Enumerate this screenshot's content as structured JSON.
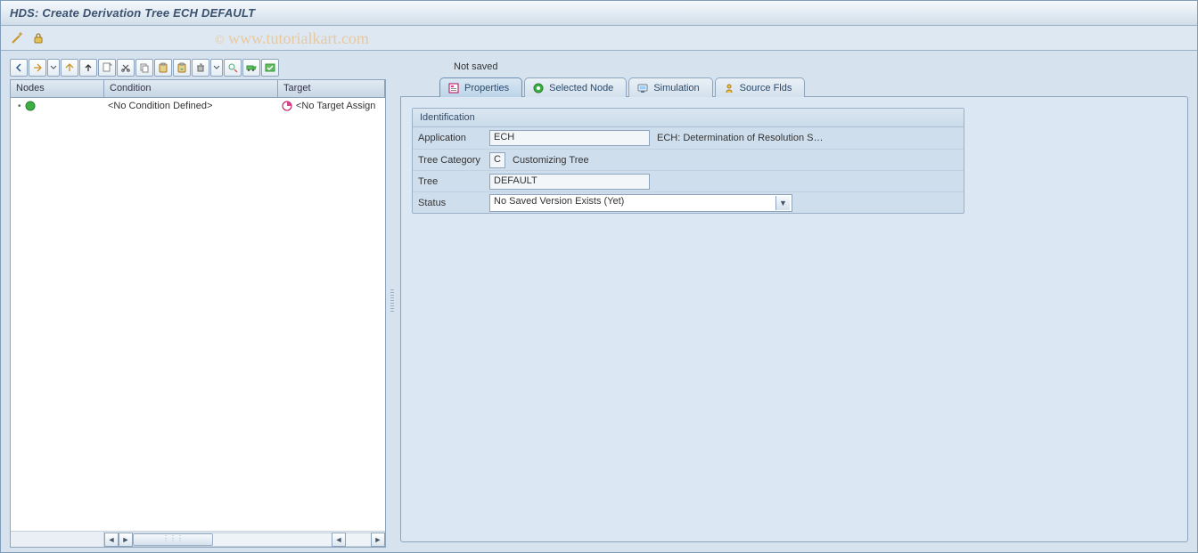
{
  "title": "HDS: Create Derivation Tree ECH DEFAULT",
  "watermark": "© www.tutorialkart.com",
  "appToolbar": {
    "items": [
      "wand-icon",
      "lock-icon"
    ]
  },
  "treeToolbar": {
    "buttons": [
      "nav-back",
      "expand-all",
      "drop",
      "collapse-all",
      "move-up",
      "create",
      "cut",
      "copy",
      "paste",
      "paste-sub",
      "delete",
      "drop2",
      "find",
      "transport",
      "check"
    ]
  },
  "tree": {
    "columns": {
      "nodes": "Nodes",
      "condition": "Condition",
      "target": "Target"
    },
    "rows": [
      {
        "condition": "<No Condition Defined>",
        "target": "<No Target Assign"
      }
    ]
  },
  "rightStatus": "Not saved",
  "tabs": [
    {
      "id": "properties",
      "label": "Properties",
      "active": true
    },
    {
      "id": "selected-node",
      "label": "Selected Node",
      "active": false
    },
    {
      "id": "simulation",
      "label": "Simulation",
      "active": false
    },
    {
      "id": "source-flds",
      "label": "Source Flds",
      "active": false
    }
  ],
  "identification": {
    "title": "Identification",
    "applicationLabel": "Application",
    "applicationValue": "ECH",
    "applicationDesc": "ECH: Determination of Resolution S…",
    "treeCategoryLabel": "Tree Category",
    "treeCategoryCode": "C",
    "treeCategoryDesc": "Customizing Tree",
    "treeLabel": "Tree",
    "treeValue": "DEFAULT",
    "statusLabel": "Status",
    "statusValue": "No Saved Version Exists (Yet)"
  }
}
